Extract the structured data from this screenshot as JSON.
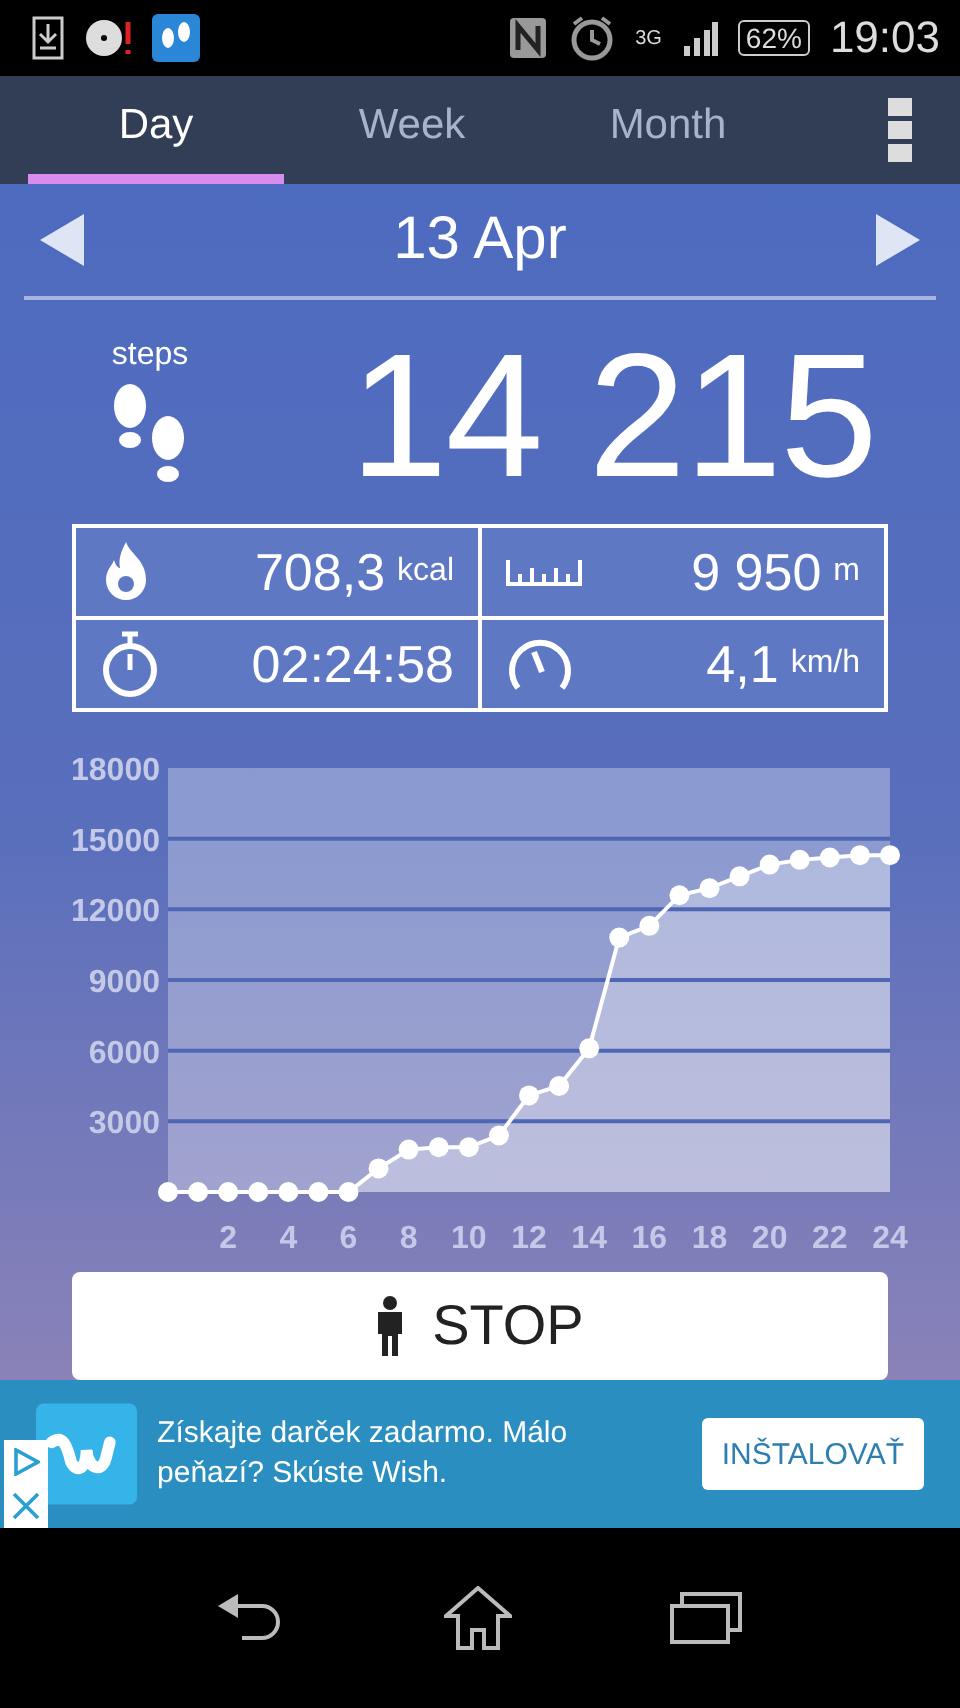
{
  "status_bar": {
    "network": "3G",
    "battery": "62%",
    "time": "19:03"
  },
  "tabs": [
    {
      "label": "Day",
      "selected": true
    },
    {
      "label": "Week",
      "selected": false
    },
    {
      "label": "Month",
      "selected": false
    }
  ],
  "date": "13 Apr",
  "steps": {
    "label": "steps",
    "value": "14 215"
  },
  "stats": [
    {
      "kind": "calories",
      "value": "708,3",
      "unit": "kcal"
    },
    {
      "kind": "distance",
      "value": "9 950",
      "unit": "m"
    },
    {
      "kind": "duration",
      "value": "02:24:58"
    },
    {
      "kind": "speed",
      "value": "4,1",
      "unit": "km/h"
    }
  ],
  "chart_data": {
    "type": "line",
    "x": [
      0,
      1,
      2,
      3,
      4,
      5,
      6,
      7,
      8,
      9,
      10,
      11,
      12,
      13,
      14,
      15,
      16,
      17,
      18,
      19,
      20,
      21,
      22,
      23,
      24
    ],
    "grid": true,
    "series": [
      {
        "color": "#ffffff",
        "marker": true,
        "values": [
          0,
          0,
          0,
          0,
          0,
          0,
          0,
          1000,
          1800,
          1900,
          1900,
          2400,
          4100,
          4500,
          6100,
          10800,
          11300,
          12600,
          12900,
          13400,
          13900,
          14100,
          14200,
          14300,
          14300
        ]
      }
    ],
    "xlim": [
      0,
      24
    ],
    "ylim": [
      0,
      18000
    ],
    "xticks": [
      2,
      4,
      6,
      8,
      10,
      12,
      14,
      16,
      18,
      20,
      22,
      24
    ],
    "yticks": [
      3000,
      6000,
      9000,
      12000,
      15000,
      18000
    ]
  },
  "stop_button": "STOP",
  "ad": {
    "text": "Získajte darček zadarmo. Málo peňazí? Skúste Wish.",
    "button": "INŠTALOVAŤ"
  }
}
